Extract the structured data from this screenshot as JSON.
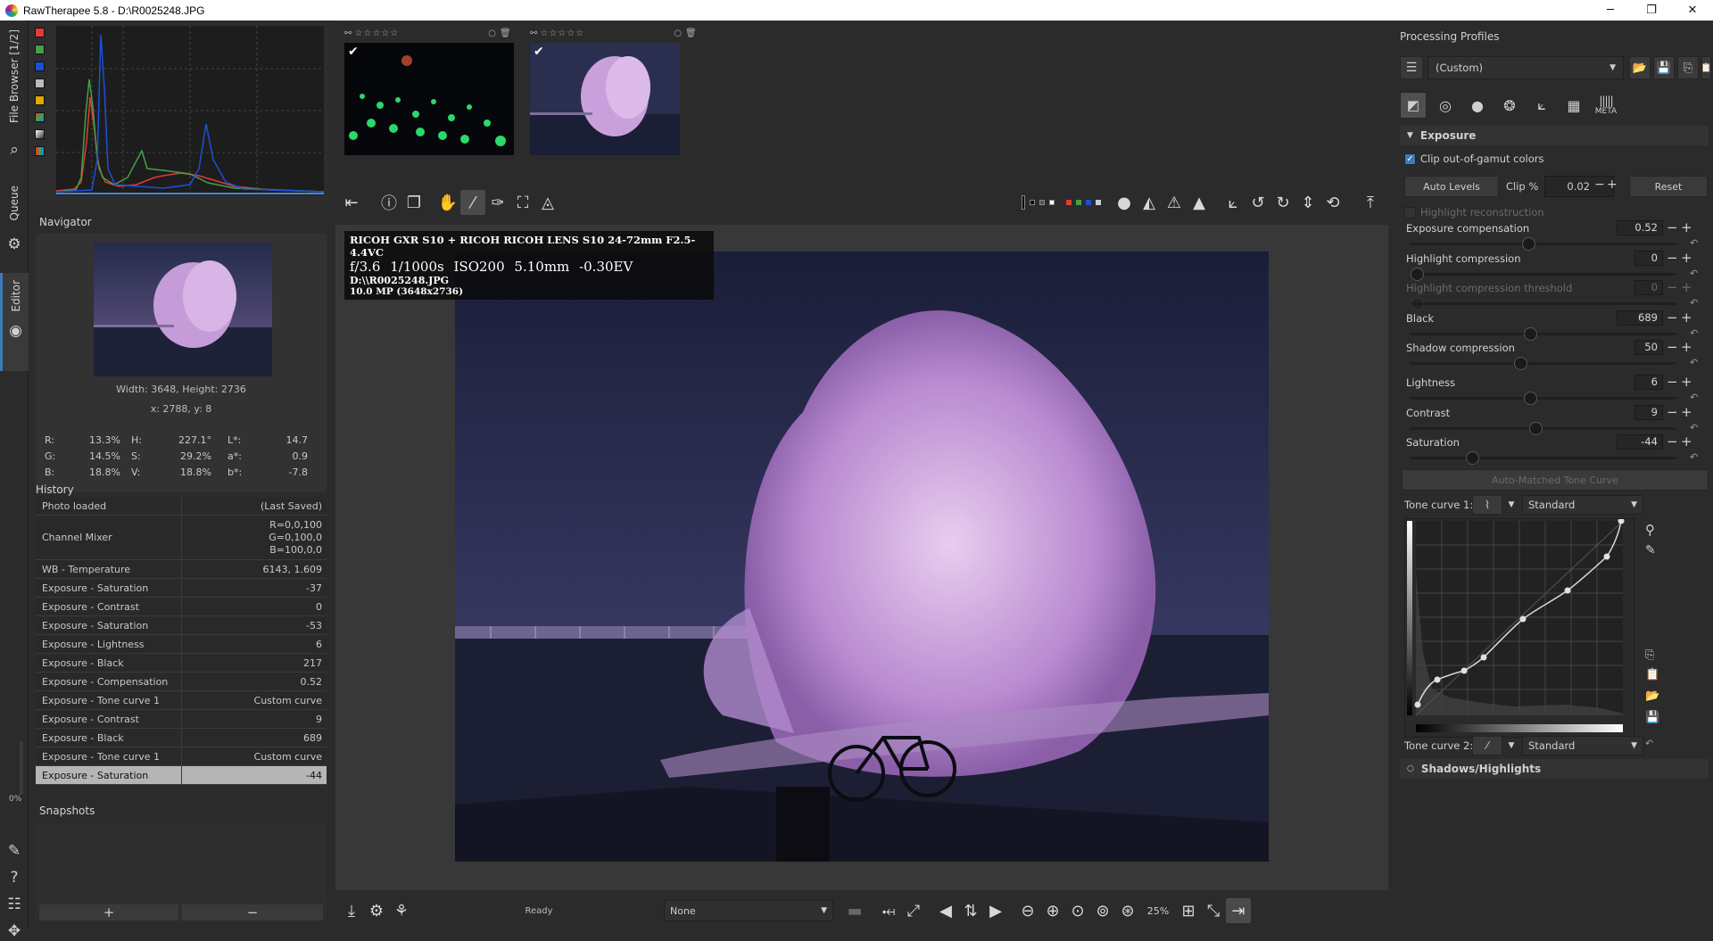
{
  "window": {
    "title": "RawTherapee 5.8 - D:\\R0025248.JPG",
    "minimize": "─",
    "maximize": "❐",
    "close": "✕"
  },
  "left_tabs": {
    "file_browser": "File Browser [1/2]",
    "queue": "Queue",
    "editor": "Editor",
    "progress": "0%"
  },
  "navigator": {
    "title": "Navigator",
    "size_text": "Width: 3648, Height: 2736",
    "coords_text": "x: 2788, y: 8",
    "readout": [
      {
        "a": "R:",
        "av": "13.3%",
        "b": "H:",
        "bv": "227.1°",
        "c": "L*:",
        "cv": "14.7"
      },
      {
        "a": "G:",
        "av": "14.5%",
        "b": "S:",
        "bv": "29.2%",
        "c": "a*:",
        "cv": "0.9"
      },
      {
        "a": "B:",
        "av": "18.8%",
        "b": "V:",
        "bv": "18.8%",
        "c": "b*:",
        "cv": "-7.8"
      }
    ]
  },
  "history": {
    "title": "History",
    "rows": [
      {
        "name": "Photo loaded",
        "value": "(Last Saved)"
      },
      {
        "name": "Channel Mixer",
        "value": "R=0,0,100\nG=0,100,0\nB=100,0,0"
      },
      {
        "name": "WB - Temperature",
        "value": "6143, 1.609"
      },
      {
        "name": "Exposure - Saturation",
        "value": "-37"
      },
      {
        "name": "Exposure - Contrast",
        "value": "0"
      },
      {
        "name": "Exposure - Saturation",
        "value": "-53"
      },
      {
        "name": "Exposure - Lightness",
        "value": "6"
      },
      {
        "name": "Exposure - Black",
        "value": "217"
      },
      {
        "name": "Exposure - Compensation",
        "value": "0.52"
      },
      {
        "name": "Exposure - Tone curve 1",
        "value": "Custom curve"
      },
      {
        "name": "Exposure - Contrast",
        "value": "9"
      },
      {
        "name": "Exposure - Black",
        "value": "689"
      },
      {
        "name": "Exposure - Tone curve 1",
        "value": "Custom curve"
      },
      {
        "name": "Exposure - Saturation",
        "value": "-44"
      }
    ]
  },
  "snapshots": {
    "title": "Snapshots",
    "add": "+",
    "remove": "−"
  },
  "filmstrip": {
    "thumbs": [
      {
        "stars": "☆☆☆☆☆"
      },
      {
        "stars": "☆☆☆☆☆"
      }
    ]
  },
  "info_overlay": {
    "camera": "RICOH GXR S10 + RICOH RICOH LENS S10 24-72mm F2.5-4.4VC",
    "aperture": "f/3.6",
    "shutter": "1/1000s",
    "iso": "ISO200",
    "focal": "5.10mm",
    "ev": "-0.30EV",
    "path": "D:\\\\R0025248.JPG",
    "mp": "10.0 MP (3648x2736)"
  },
  "bottombar": {
    "status": "Ready",
    "select_value": "None",
    "zoom": "25%"
  },
  "right": {
    "profiles_title": "Processing Profiles",
    "profile_value": "(Custom)",
    "meta_tab": "META",
    "exposure_title": "Exposure",
    "clip_gamut": "Clip out-of-gamut colors",
    "auto_levels": "Auto Levels",
    "clip_label": "Clip %",
    "clip_value": "0.02",
    "reset": "Reset",
    "highlight_recon": "Highlight reconstruction",
    "sliders": [
      {
        "label": "Exposure compensation",
        "value": "0.52",
        "pos": 0.44,
        "dim": false
      },
      {
        "label": "Highlight compression",
        "value": "0",
        "pos": 0.0,
        "dim": false
      },
      {
        "label": "Highlight compression threshold",
        "value": "0",
        "pos": 0.0,
        "dim": true
      },
      {
        "label": "Black",
        "value": "689",
        "pos": 0.45,
        "dim": false
      },
      {
        "label": "Shadow compression",
        "value": "50",
        "pos": 0.41,
        "dim": false
      },
      {
        "label": "Lightness",
        "value": "6",
        "pos": 0.45,
        "dim": false
      },
      {
        "label": "Contrast",
        "value": "9",
        "pos": 0.47,
        "dim": false
      },
      {
        "label": "Saturation",
        "value": "-44",
        "pos": 0.22,
        "dim": false
      }
    ],
    "auto_tone_curve": "Auto-Matched Tone Curve",
    "tone_curve_1": "Tone curve 1:",
    "tone_curve_1_type": "Standard",
    "tone_curve_2": "Tone curve 2:",
    "tone_curve_2_type": "Standard",
    "shadows_highlights": "Shadows/Highlights"
  }
}
